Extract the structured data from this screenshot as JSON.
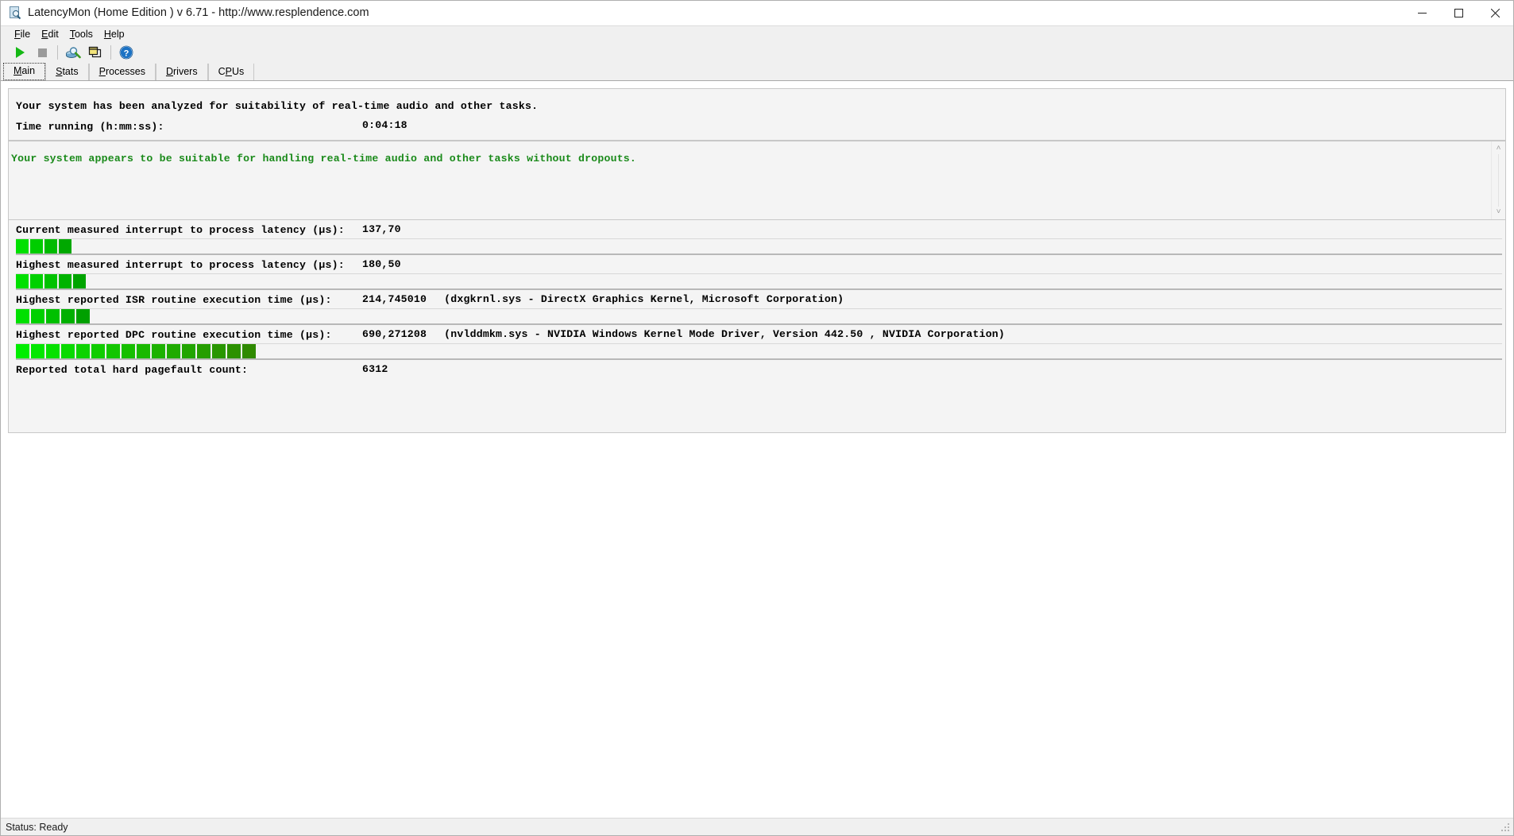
{
  "window": {
    "title": "LatencyMon  (Home Edition )  v 6.71 - http://www.resplendence.com",
    "icon": "latencymon-app-icon",
    "minimize_label": "Minimize",
    "maximize_label": "Maximize",
    "close_label": "Close"
  },
  "menubar": {
    "items": [
      {
        "label": "File",
        "accel": "F"
      },
      {
        "label": "Edit",
        "accel": "E"
      },
      {
        "label": "Tools",
        "accel": "T"
      },
      {
        "label": "Help",
        "accel": "H"
      }
    ]
  },
  "toolbar": {
    "buttons": [
      {
        "name": "start-monitoring-button",
        "icon": "play-icon",
        "tooltip": "Start monitoring"
      },
      {
        "name": "stop-monitoring-button",
        "icon": "stop-icon",
        "tooltip": "Stop monitoring"
      },
      {
        "name": "system-info-button",
        "icon": "disk-magnifier-icon",
        "tooltip": "System information"
      },
      {
        "name": "copy-report-button",
        "icon": "copy-windows-icon",
        "tooltip": "Copy report"
      },
      {
        "name": "help-button",
        "icon": "help-question-icon",
        "tooltip": "Help"
      }
    ]
  },
  "tabs": [
    {
      "label": "Main",
      "accel": "M",
      "selected": true
    },
    {
      "label": "Stats",
      "accel": "S",
      "selected": false
    },
    {
      "label": "Processes",
      "accel": "P",
      "selected": false
    },
    {
      "label": "Drivers",
      "accel": "D",
      "selected": false
    },
    {
      "label": "CPUs",
      "accel": "C",
      "selected": false
    }
  ],
  "main": {
    "analyzed_line": "Your system has been analyzed for suitability of real-time audio and other tasks.",
    "time_running_label": "Time running (h:mm:ss):",
    "time_running_value": "0:04:18",
    "verdict": "Your system appears to be suitable for handling real-time audio and other tasks without dropouts.",
    "verdict_color": "#1a8a1a",
    "metrics": [
      {
        "name": "current-interrupt-to-process-latency",
        "label": "Current measured interrupt to process latency (µs):",
        "value": "137,70",
        "extra": "",
        "bar_segments": 4,
        "bar_segment_width": 16,
        "bar_start_color": "#00e000",
        "bar_end_color": "#00a800"
      },
      {
        "name": "highest-interrupt-to-process-latency",
        "label": "Highest measured interrupt to process latency (µs):",
        "value": "180,50",
        "extra": "",
        "bar_segments": 5,
        "bar_segment_width": 16,
        "bar_start_color": "#00e000",
        "bar_end_color": "#00a400"
      },
      {
        "name": "highest-isr-routine-execution-time",
        "label": "Highest reported ISR routine execution time (µs):",
        "value": "214,745010",
        "extra": "(dxgkrnl.sys - DirectX Graphics Kernel, Microsoft Corporation)",
        "bar_segments": 5,
        "bar_segment_width": 17,
        "bar_start_color": "#00e000",
        "bar_end_color": "#00a000"
      },
      {
        "name": "highest-dpc-routine-execution-time",
        "label": "Highest reported DPC routine execution time (µs):",
        "value": "690,271208",
        "extra": "(nvlddmkm.sys - NVIDIA Windows Kernel Mode Driver, Version 442.50 , NVIDIA Corporation)",
        "bar_segments": 16,
        "bar_segment_width": 17,
        "bar_start_color": "#00ee00",
        "bar_end_color": "#2f8a00"
      },
      {
        "name": "reported-hard-pagefault-count",
        "label": "Reported total hard pagefault count:",
        "value": "6312",
        "extra": "",
        "bar_segments": 0,
        "bar_segment_width": 0,
        "bar_start_color": "#00e000",
        "bar_end_color": "#00a000"
      }
    ]
  },
  "scrollbar": {
    "up_arrow": "˄",
    "down_arrow": "˅"
  },
  "statusbar": {
    "text": "Status: Ready"
  }
}
